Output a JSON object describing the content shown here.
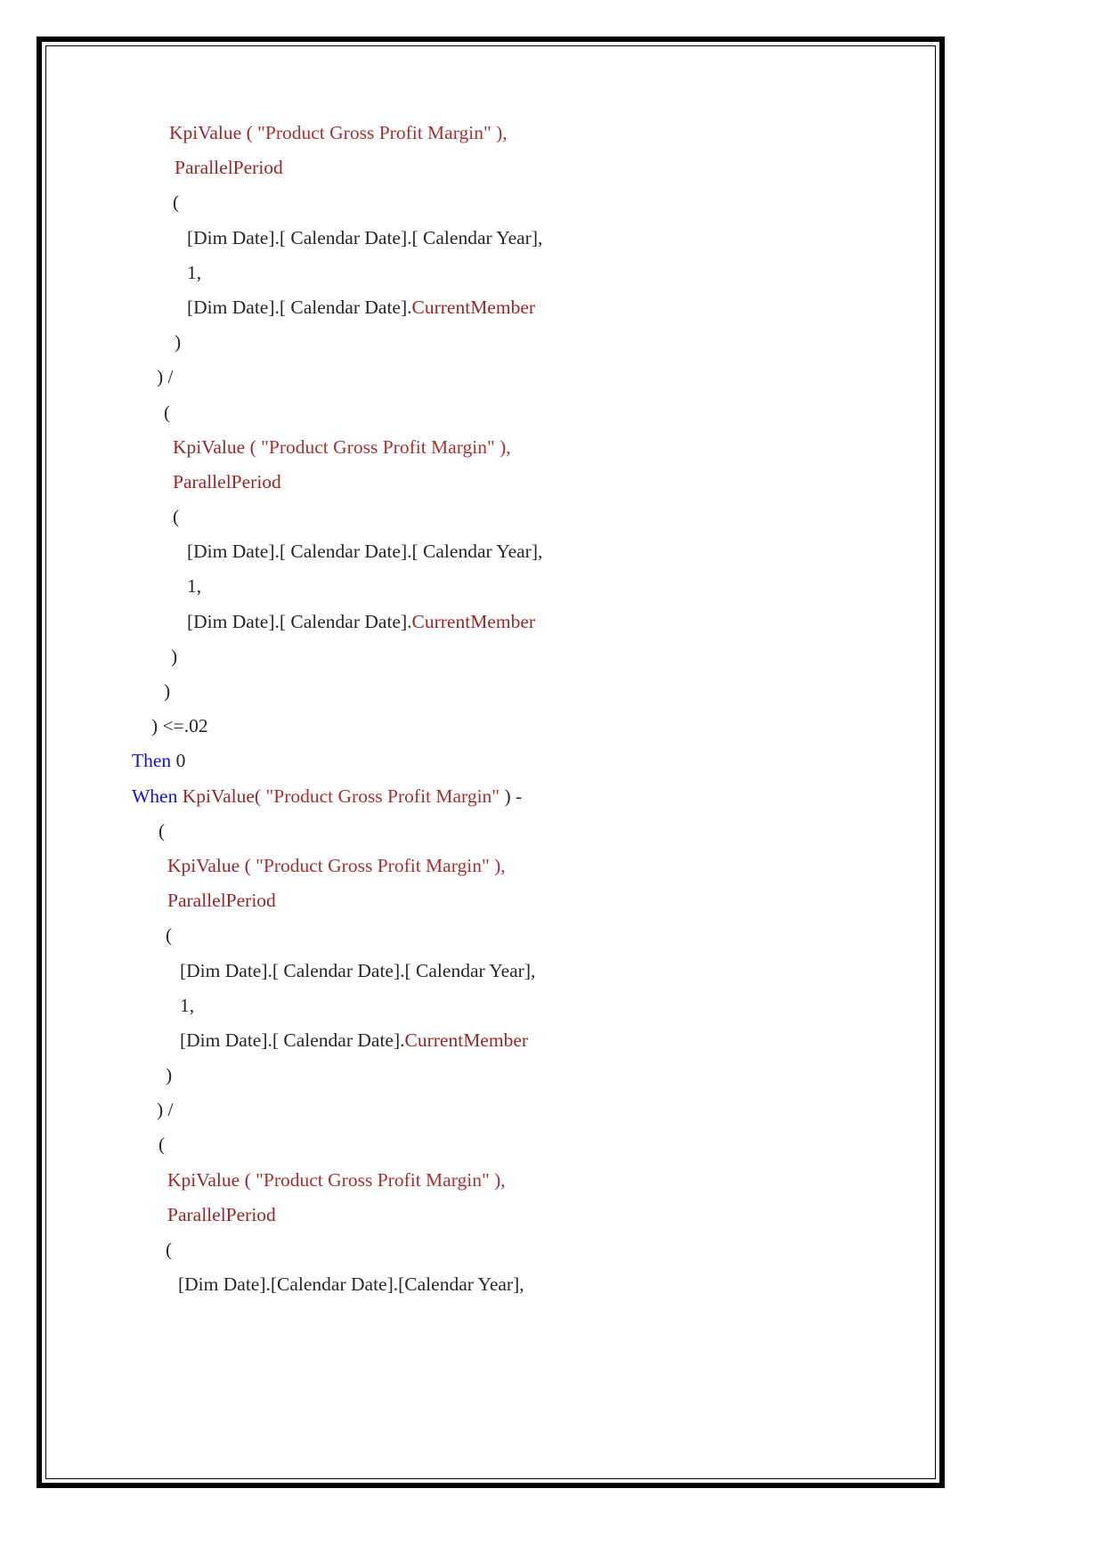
{
  "document": {
    "type": "code-listing-page",
    "language": "MDX",
    "colors": {
      "function": "#9c2525",
      "string": "#a8312f",
      "keyword": "#1111dd",
      "plain": "#262626",
      "border": "#000000",
      "page_background": "#ffffff"
    },
    "lines": [
      {
        "indent": 42,
        "tokens": [
          {
            "t": "KpiValue",
            "c": "fn"
          },
          {
            "t": " ( ",
            "c": "fn"
          },
          {
            "t": "\"Product Gross Profit Margin\"",
            "c": "str"
          },
          {
            "t": " ),",
            "c": "str"
          }
        ]
      },
      {
        "indent": 48,
        "tokens": [
          {
            "t": "ParallelPeriod",
            "c": "fn"
          }
        ]
      },
      {
        "indent": 46,
        "tokens": [
          {
            "t": "(",
            "c": "plain"
          }
        ]
      },
      {
        "indent": 62,
        "tokens": [
          {
            "t": "[Dim Date].[ Calendar Date].[ Calendar Year],",
            "c": "plain"
          }
        ]
      },
      {
        "indent": 62,
        "tokens": [
          {
            "t": "1,",
            "c": "plain"
          }
        ]
      },
      {
        "indent": 62,
        "tokens": [
          {
            "t": "[Dim Date].[ Calendar Date].",
            "c": "plain"
          },
          {
            "t": "CurrentMember",
            "c": "prop"
          }
        ]
      },
      {
        "indent": 48,
        "tokens": [
          {
            "t": ")",
            "c": "plain"
          }
        ]
      },
      {
        "indent": 28,
        "tokens": [
          {
            "t": ") /",
            "c": "plain"
          }
        ]
      },
      {
        "indent": 36,
        "tokens": [
          {
            "t": "(",
            "c": "plain"
          }
        ]
      },
      {
        "indent": 46,
        "tokens": [
          {
            "t": "KpiValue",
            "c": "fn"
          },
          {
            "t": " ( ",
            "c": "fn"
          },
          {
            "t": "\"Product Gross Profit Margin\"",
            "c": "str"
          },
          {
            "t": " ),",
            "c": "str"
          }
        ]
      },
      {
        "indent": 46,
        "tokens": [
          {
            "t": "ParallelPeriod",
            "c": "fn"
          }
        ]
      },
      {
        "indent": 46,
        "tokens": [
          {
            "t": "(",
            "c": "plain"
          }
        ]
      },
      {
        "indent": 62,
        "tokens": [
          {
            "t": "[Dim Date].[ Calendar Date].[ Calendar Year],",
            "c": "plain"
          }
        ]
      },
      {
        "indent": 62,
        "tokens": [
          {
            "t": "1,",
            "c": "plain"
          }
        ]
      },
      {
        "indent": 62,
        "tokens": [
          {
            "t": "[Dim Date].[ Calendar Date].",
            "c": "plain"
          },
          {
            "t": "CurrentMember",
            "c": "prop"
          }
        ]
      },
      {
        "indent": 44,
        "tokens": [
          {
            "t": ")",
            "c": "plain"
          }
        ]
      },
      {
        "indent": 36,
        "tokens": [
          {
            "t": ")",
            "c": "plain"
          }
        ]
      },
      {
        "indent": 22,
        "tokens": [
          {
            "t": ") <=.02",
            "c": "plain"
          }
        ]
      },
      {
        "indent": 0,
        "tokens": [
          {
            "t": "Then",
            "c": "kw"
          },
          {
            "t": " 0",
            "c": "plain"
          }
        ]
      },
      {
        "indent": 0,
        "tokens": [
          {
            "t": "When",
            "c": "kw"
          },
          {
            "t": " ",
            "c": "plain"
          },
          {
            "t": "KpiValue(",
            "c": "fn"
          },
          {
            "t": " \"Product Gross Profit Margin\"",
            "c": "str"
          },
          {
            "t": " ) -",
            "c": "plain"
          }
        ]
      },
      {
        "indent": 30,
        "tokens": [
          {
            "t": "(",
            "c": "plain"
          }
        ]
      },
      {
        "indent": 40,
        "tokens": [
          {
            "t": "KpiValue",
            "c": "fn"
          },
          {
            "t": " ( ",
            "c": "fn"
          },
          {
            "t": "\"Product Gross Profit Margin\"",
            "c": "str"
          },
          {
            "t": " ),",
            "c": "str"
          }
        ]
      },
      {
        "indent": 40,
        "tokens": [
          {
            "t": "ParallelPeriod",
            "c": "fn"
          }
        ]
      },
      {
        "indent": 38,
        "tokens": [
          {
            "t": "(",
            "c": "plain"
          }
        ]
      },
      {
        "indent": 54,
        "tokens": [
          {
            "t": "[Dim Date].[ Calendar Date].[ Calendar Year],",
            "c": "plain"
          }
        ]
      },
      {
        "indent": 54,
        "tokens": [
          {
            "t": "1,",
            "c": "plain"
          }
        ]
      },
      {
        "indent": 54,
        "tokens": [
          {
            "t": "[Dim Date].[ Calendar Date].",
            "c": "plain"
          },
          {
            "t": "CurrentMember",
            "c": "prop"
          }
        ]
      },
      {
        "indent": 38,
        "tokens": [
          {
            "t": ")",
            "c": "plain"
          }
        ]
      },
      {
        "indent": 28,
        "tokens": [
          {
            "t": ") /",
            "c": "plain"
          }
        ]
      },
      {
        "indent": 30,
        "tokens": [
          {
            "t": "(",
            "c": "plain"
          }
        ]
      },
      {
        "indent": 40,
        "tokens": [
          {
            "t": "KpiValue",
            "c": "fn"
          },
          {
            "t": " ( ",
            "c": "fn"
          },
          {
            "t": "\"Product Gross Profit Margin\"",
            "c": "str"
          },
          {
            "t": " ),",
            "c": "str"
          }
        ]
      },
      {
        "indent": 40,
        "tokens": [
          {
            "t": "ParallelPeriod",
            "c": "fn"
          }
        ]
      },
      {
        "indent": 38,
        "tokens": [
          {
            "t": "(",
            "c": "plain"
          }
        ]
      },
      {
        "indent": 52,
        "tokens": [
          {
            "t": "[Dim Date].[Calendar Date].[Calendar Year],",
            "c": "plain"
          }
        ]
      }
    ]
  }
}
